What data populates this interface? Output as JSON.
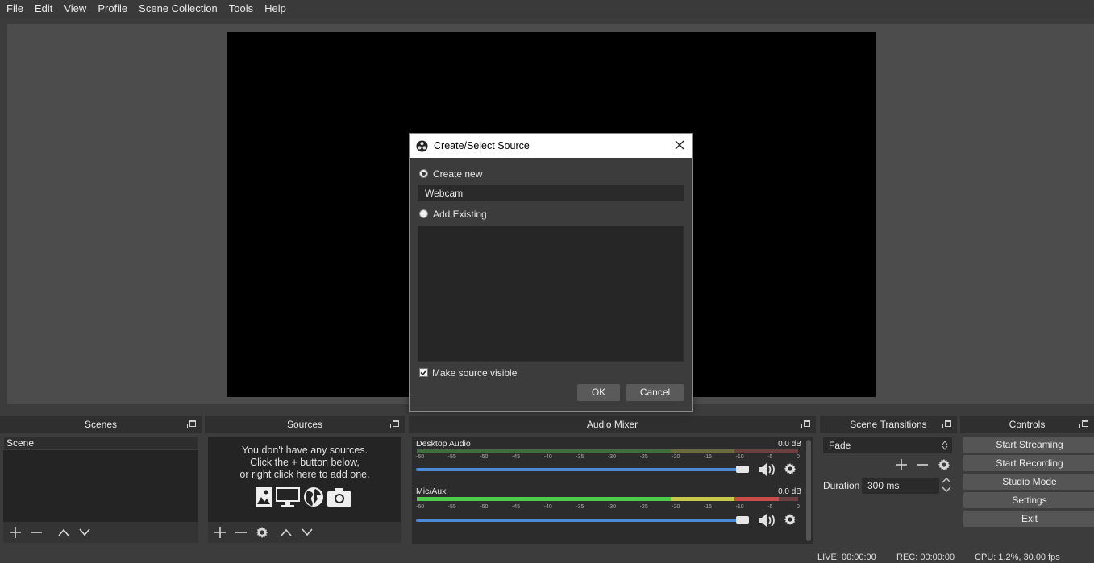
{
  "menu": [
    "File",
    "Edit",
    "View",
    "Profile",
    "Scene Collection",
    "Tools",
    "Help"
  ],
  "docks": {
    "scenes": {
      "title": "Scenes",
      "items": [
        "Scene"
      ]
    },
    "sources": {
      "title": "Sources",
      "empty_lines": [
        "You don't have any sources.",
        "Click the + button below,",
        "or right click here to add one."
      ]
    },
    "mixer": {
      "title": "Audio Mixer",
      "channels": [
        {
          "name": "Desktop Audio",
          "db": "0.0 dB",
          "level": 0,
          "volume": 1.0
        },
        {
          "name": "Mic/Aux",
          "db": "0.0 dB",
          "level": 0.95,
          "volume": 1.0
        }
      ],
      "scale": [
        "-60",
        "-55",
        "-50",
        "-45",
        "-40",
        "-35",
        "-30",
        "-25",
        "-20",
        "-15",
        "-10",
        "-5",
        "0"
      ]
    },
    "transitions": {
      "title": "Scene Transitions",
      "selected": "Fade",
      "duration_label": "Duration",
      "duration_value": "300 ms"
    },
    "controls": {
      "title": "Controls",
      "buttons": [
        "Start Streaming",
        "Start Recording",
        "Studio Mode",
        "Settings",
        "Exit"
      ]
    }
  },
  "status": {
    "live": "LIVE: 00:00:00",
    "rec": "REC: 00:00:00",
    "cpu": "CPU: 1.2%, 30.00 fps"
  },
  "dialog": {
    "title": "Create/Select Source",
    "create_new_label": "Create new",
    "name_value": "Webcam",
    "add_existing_label": "Add Existing",
    "visible_label": "Make source visible",
    "visible_checked": true,
    "ok_label": "OK",
    "cancel_label": "Cancel"
  },
  "colors": {
    "accent": "#4a8ad8",
    "meter_green": "#4ccd4c",
    "meter_yellow": "#c8c84c",
    "meter_red": "#c84c4c"
  }
}
